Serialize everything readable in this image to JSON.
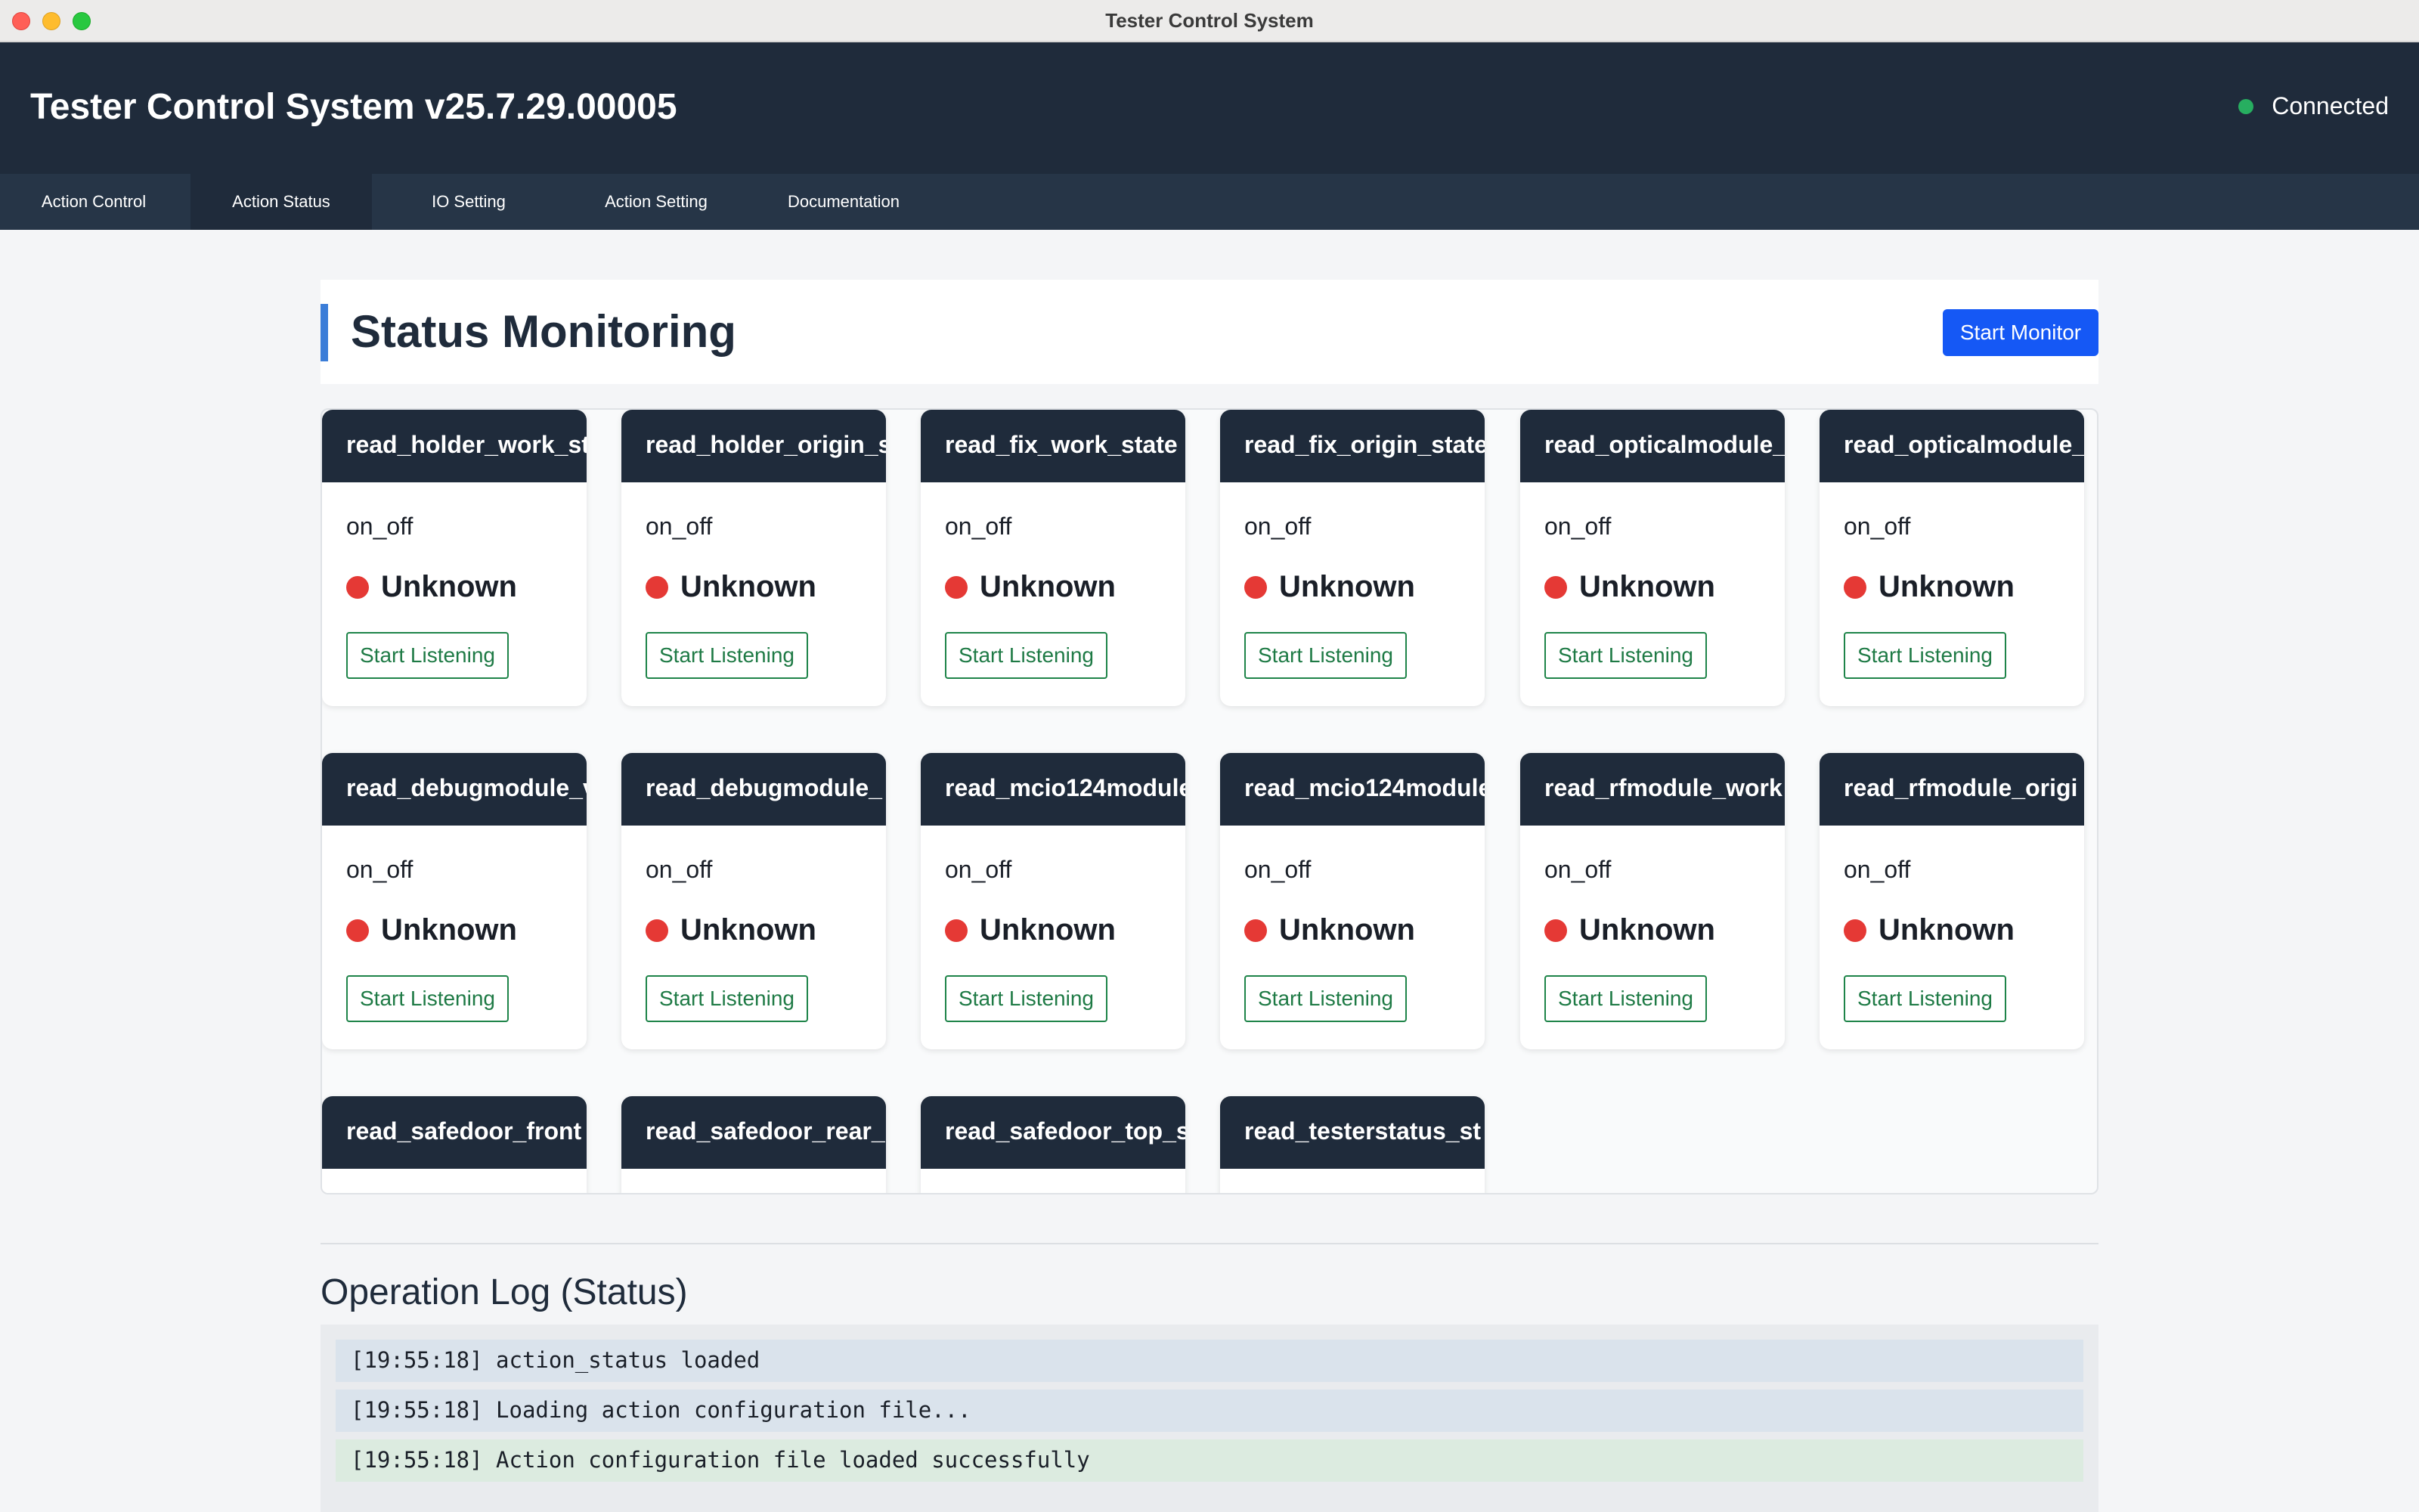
{
  "window": {
    "title": "Tester Control System"
  },
  "header": {
    "app_title": "Tester Control System v25.7.29.00005",
    "connection_status": "Connected",
    "connection_color": "#27ae60"
  },
  "tabs": [
    {
      "label": "Action Control",
      "active": false
    },
    {
      "label": "Action Status",
      "active": true
    },
    {
      "label": "IO Setting",
      "active": false
    },
    {
      "label": "Action Setting",
      "active": false
    },
    {
      "label": "Documentation",
      "active": false
    }
  ],
  "status_panel": {
    "title": "Status Monitoring",
    "start_monitor_label": "Start Monitor"
  },
  "cards": [
    {
      "name": "read_holder_work_st",
      "type": "on_off",
      "state": "Unknown",
      "button": "Start Listening"
    },
    {
      "name": "read_holder_origin_s",
      "type": "on_off",
      "state": "Unknown",
      "button": "Start Listening"
    },
    {
      "name": "read_fix_work_state",
      "type": "on_off",
      "state": "Unknown",
      "button": "Start Listening"
    },
    {
      "name": "read_fix_origin_state",
      "type": "on_off",
      "state": "Unknown",
      "button": "Start Listening"
    },
    {
      "name": "read_opticalmodule_",
      "type": "on_off",
      "state": "Unknown",
      "button": "Start Listening"
    },
    {
      "name": "read_opticalmodule_",
      "type": "on_off",
      "state": "Unknown",
      "button": "Start Listening"
    },
    {
      "name": "read_debugmodule_v",
      "type": "on_off",
      "state": "Unknown",
      "button": "Start Listening"
    },
    {
      "name": "read_debugmodule_",
      "type": "on_off",
      "state": "Unknown",
      "button": "Start Listening"
    },
    {
      "name": "read_mcio124module",
      "type": "on_off",
      "state": "Unknown",
      "button": "Start Listening"
    },
    {
      "name": "read_mcio124module",
      "type": "on_off",
      "state": "Unknown",
      "button": "Start Listening"
    },
    {
      "name": "read_rfmodule_work",
      "type": "on_off",
      "state": "Unknown",
      "button": "Start Listening"
    },
    {
      "name": "read_rfmodule_origi",
      "type": "on_off",
      "state": "Unknown",
      "button": "Start Listening"
    },
    {
      "name": "read_safedoor_front",
      "type": "",
      "state": "",
      "button": ""
    },
    {
      "name": "read_safedoor_rear_",
      "type": "",
      "state": "",
      "button": ""
    },
    {
      "name": "read_safedoor_top_s",
      "type": "",
      "state": "",
      "button": ""
    },
    {
      "name": "read_testerstatus_st",
      "type": "",
      "state": "",
      "button": ""
    }
  ],
  "state_color": "#e53935",
  "log": {
    "title": "Operation Log (Status)",
    "lines": [
      {
        "text": "[19:55:18] action_status loaded",
        "kind": "info"
      },
      {
        "text": "[19:55:18] Loading action configuration file...",
        "kind": "info"
      },
      {
        "text": "[19:55:18] Action configuration file loaded successfully",
        "kind": "success"
      }
    ]
  }
}
